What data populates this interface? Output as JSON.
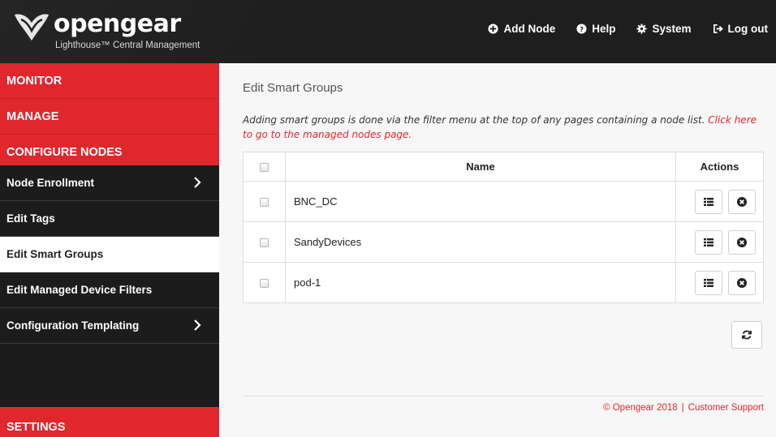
{
  "brand": {
    "name": "opengear",
    "subtitle": "Lighthouse™ Central Management"
  },
  "topnav": {
    "add_node": "Add Node",
    "help": "Help",
    "system": "System",
    "logout": "Log out"
  },
  "sidebar": {
    "monitor": "MONITOR",
    "manage": "MANAGE",
    "configure_nodes": "CONFIGURE NODES",
    "items": [
      {
        "label": "Node Enrollment"
      },
      {
        "label": "Edit Tags"
      },
      {
        "label": "Edit Smart Groups"
      },
      {
        "label": "Edit Managed Device Filters"
      },
      {
        "label": "Configuration Templating"
      }
    ],
    "settings": "SETTINGS"
  },
  "main": {
    "title": "Edit Smart Groups",
    "info_text": "Adding smart groups is done via the filter menu at the top of any pages containing a node list. ",
    "info_link": "Click here to go to the managed nodes page.",
    "table": {
      "headers": {
        "name": "Name",
        "actions": "Actions"
      },
      "rows": [
        {
          "name": "BNC_DC"
        },
        {
          "name": "SandyDevices"
        },
        {
          "name": "pod-1"
        }
      ]
    }
  },
  "footer": {
    "copyright": "© Opengear 2018",
    "separator": "|",
    "support": "Customer Support"
  },
  "colors": {
    "accent_red": "#e0272e",
    "topbar": "#1e1e1e",
    "sidebar": "#1c1c1c"
  }
}
